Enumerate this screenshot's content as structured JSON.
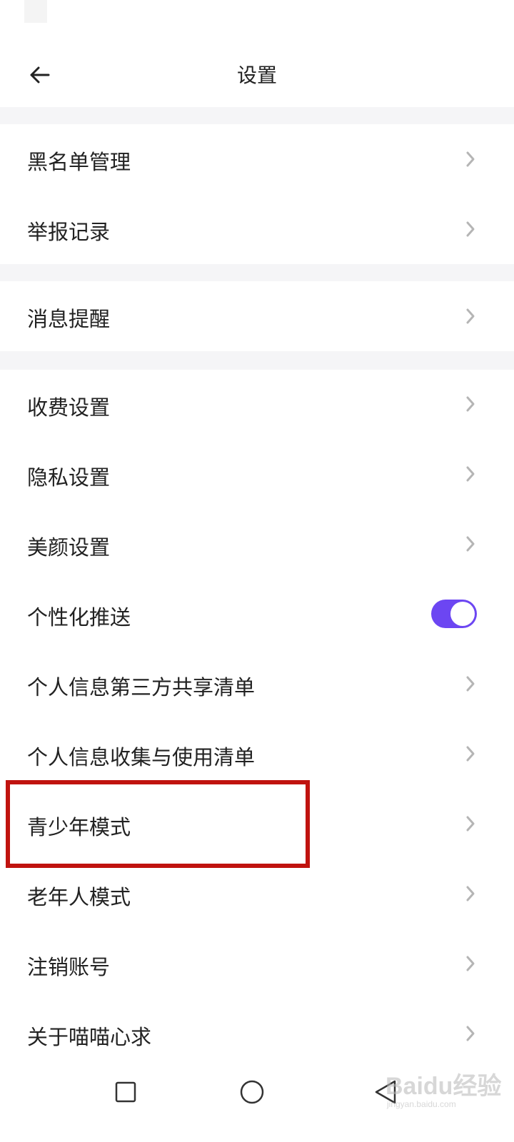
{
  "header": {
    "title": "设置"
  },
  "menu_groups": {
    "group1": [
      {
        "label": "黑名单管理"
      },
      {
        "label": "举报记录"
      }
    ],
    "group2": [
      {
        "label": "消息提醒"
      }
    ],
    "group3": [
      {
        "label": "收费设置"
      },
      {
        "label": "隐私设置"
      },
      {
        "label": "美颜设置"
      },
      {
        "label": "个性化推送",
        "toggle_on": true
      },
      {
        "label": "个人信息第三方共享清单"
      },
      {
        "label": "个人信息收集与使用清单"
      },
      {
        "label": "青少年模式",
        "highlighted": true
      },
      {
        "label": "老年人模式"
      },
      {
        "label": "注销账号"
      },
      {
        "label": "关于喵喵心求"
      }
    ]
  },
  "watermark": {
    "logo": "Baidu经验",
    "sub": "jingyan.baidu.com"
  },
  "colors": {
    "accent": "#6c46f2",
    "highlight_border": "#c0130f",
    "section_gap": "#f5f5f7",
    "chevron": "#b5b5b5"
  },
  "icons": {
    "back": "back-arrow-icon",
    "chevron": "chevron-right-icon",
    "nav_recent": "square-icon",
    "nav_home": "circle-icon",
    "nav_back": "triangle-back-icon"
  }
}
